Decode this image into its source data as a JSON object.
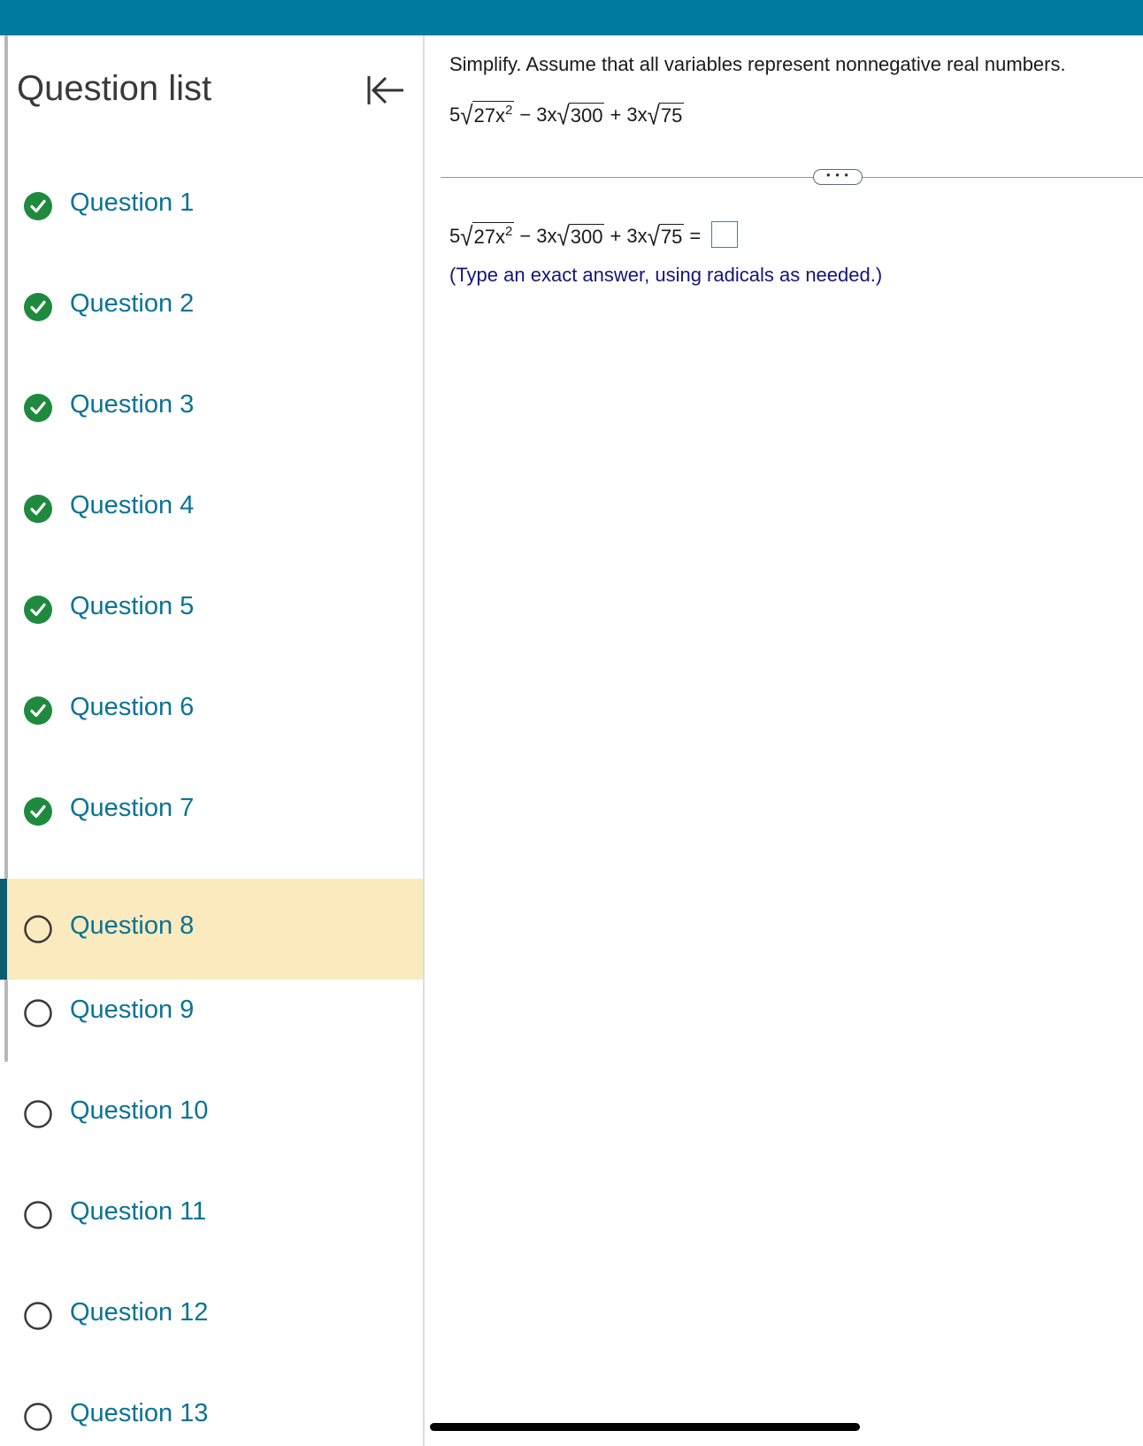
{
  "sidebar": {
    "title": "Question list",
    "collapse_icon": "collapse-left-icon",
    "current_index": 7,
    "questions": [
      {
        "label": "Question 1",
        "status": "completed"
      },
      {
        "label": "Question 2",
        "status": "completed"
      },
      {
        "label": "Question 3",
        "status": "completed"
      },
      {
        "label": "Question 4",
        "status": "completed"
      },
      {
        "label": "Question 5",
        "status": "completed"
      },
      {
        "label": "Question 6",
        "status": "completed"
      },
      {
        "label": "Question 7",
        "status": "completed"
      },
      {
        "label": "Question 8",
        "status": "unanswered"
      },
      {
        "label": "Question 9",
        "status": "unanswered"
      },
      {
        "label": "Question 10",
        "status": "unanswered"
      },
      {
        "label": "Question 11",
        "status": "unanswered"
      },
      {
        "label": "Question 12",
        "status": "unanswered"
      },
      {
        "label": "Question 13",
        "status": "unanswered"
      }
    ]
  },
  "problem": {
    "instruction": "Simplify. Assume that all variables represent nonnegative real numbers.",
    "expr": {
      "coef1": "5",
      "radicand1": "27x",
      "exp1": "2",
      "op1": "−",
      "coef2": "3x",
      "radicand2": "300",
      "op2": "+",
      "coef3": "3x",
      "radicand3": "75"
    },
    "equals": "=",
    "answer_value": "",
    "hint": "(Type an exact answer, using radicals as needed.)",
    "more_label": "• • •"
  },
  "colors": {
    "topbar": "#007a9e",
    "link": "#0a7396",
    "check": "#1f8a3e",
    "highlight": "#faeabd",
    "hint": "#15157a"
  }
}
